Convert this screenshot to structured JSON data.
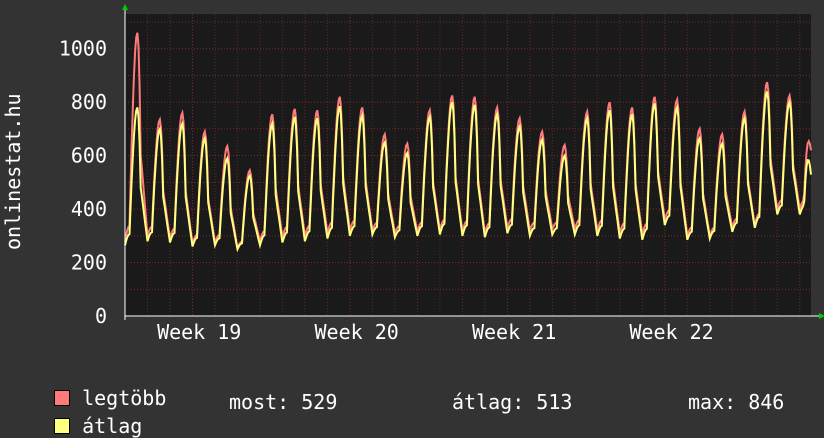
{
  "chart_data": {
    "type": "line",
    "ylabel": "onlinestat.hu",
    "ylim": [
      0,
      1130
    ],
    "yticks": [
      0,
      200,
      400,
      600,
      800,
      1000
    ],
    "x_tick_labels": [
      "Week 19",
      "Week 20",
      "Week 21",
      "Week 22"
    ],
    "x_tick_positions_days": [
      3.3,
      10.3,
      17.3,
      24.3
    ],
    "x_range_days": [
      0,
      30.5
    ],
    "grid": true,
    "colors": {
      "background": "#333333",
      "plot_bg": "#1a1a1a",
      "grid": "#7a2a2a",
      "axis": "#ffffff",
      "arrow": "#00cc00"
    },
    "series": [
      {
        "name": "legtöbb",
        "color": "#ff7a7a",
        "peaks": [
          1060,
          735,
          760,
          690,
          635,
          545,
          755,
          775,
          770,
          820,
          780,
          680,
          645,
          770,
          825,
          820,
          780,
          740,
          690,
          640,
          765,
          800,
          780,
          820,
          810,
          700,
          680,
          765,
          875,
          825
        ],
        "troughs": [
          275,
          300,
          290,
          270,
          275,
          255,
          280,
          295,
          300,
          310,
          320,
          320,
          310,
          315,
          320,
          315,
          310,
          330,
          320,
          325,
          325,
          320,
          310,
          305,
          360,
          300,
          300,
          330,
          340,
          400
        ],
        "end": 620
      },
      {
        "name": "átlag",
        "color": "#ffff80",
        "peaks": [
          780,
          700,
          720,
          665,
          590,
          525,
          720,
          745,
          740,
          785,
          750,
          650,
          610,
          745,
          800,
          790,
          755,
          710,
          660,
          600,
          740,
          770,
          755,
          795,
          780,
          665,
          645,
          740,
          840,
          800
        ],
        "troughs": [
          265,
          280,
          275,
          260,
          265,
          250,
          265,
          275,
          280,
          290,
          300,
          305,
          295,
          300,
          305,
          300,
          295,
          310,
          300,
          305,
          305,
          300,
          290,
          285,
          340,
          285,
          290,
          315,
          330,
          380
        ],
        "end": 529
      }
    ]
  },
  "legend": {
    "max_label": "legtöbb",
    "avg_label": "átlag"
  },
  "stats": {
    "now": "most: 529",
    "avg": "átlag: 513",
    "max": "max: 846"
  }
}
